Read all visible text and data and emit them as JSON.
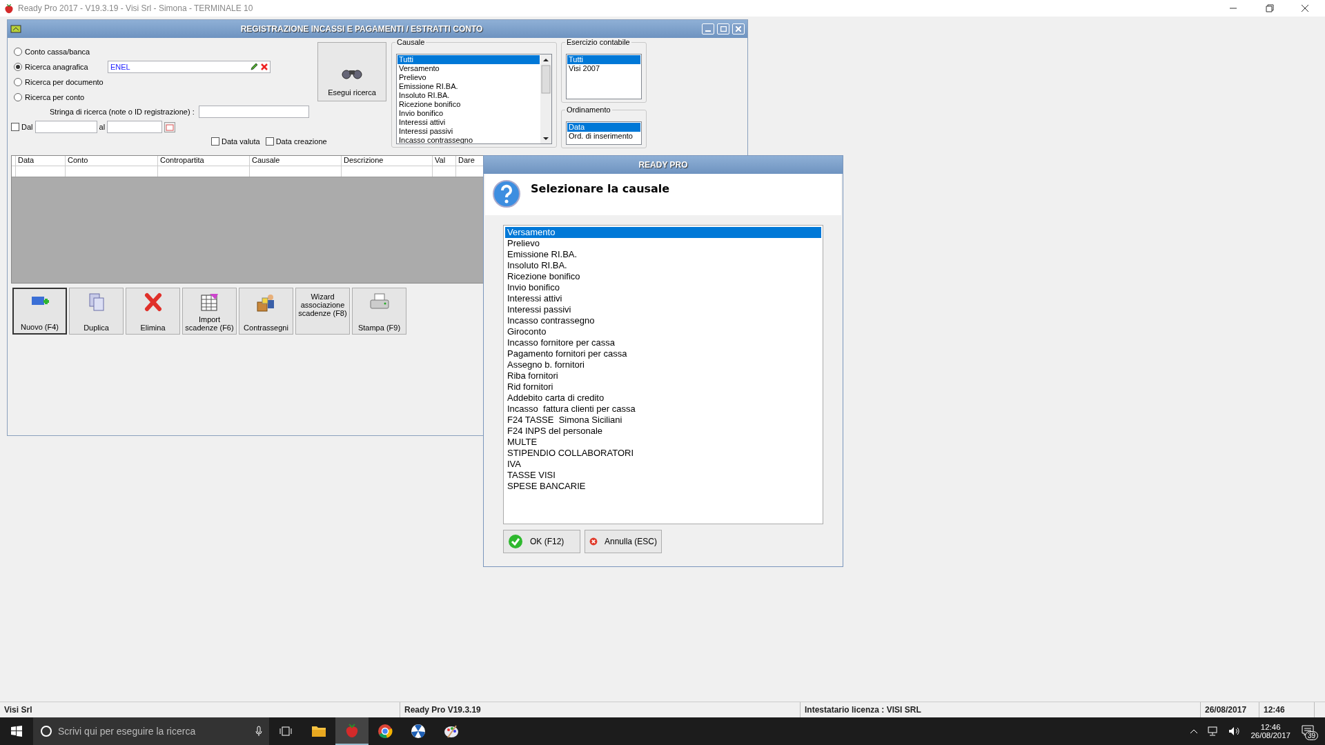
{
  "app_window": {
    "title": "Ready Pro 2017 - V19.3.19 - Visi Srl - Simona - TERMINALE 10"
  },
  "form_window": {
    "title": "REGISTRAZIONE INCASSI E PAGAMENTI / ESTRATTI CONTO",
    "search_modes": [
      {
        "label": "Conto cassa/banca",
        "selected": false
      },
      {
        "label": "Ricerca anagrafica",
        "selected": true
      },
      {
        "label": "Ricerca per documento",
        "selected": false
      },
      {
        "label": "Ricerca per conto",
        "selected": false
      }
    ],
    "search_value": "ENEL",
    "search_button": "Esegui ricerca",
    "search_string_label": "Stringa di ricerca (note o ID registrazione) :",
    "date_range": {
      "label": "Dal",
      "checked": false,
      "to_label": "al"
    },
    "date_options": [
      {
        "label": "Data valuta",
        "checked": false
      },
      {
        "label": "Data creazione",
        "checked": false
      }
    ],
    "causale": {
      "title": "Causale",
      "items": [
        {
          "label": "Tutti",
          "selected": true
        },
        {
          "label": "Versamento",
          "selected": false
        },
        {
          "label": "Prelievo",
          "selected": false
        },
        {
          "label": "Emissione RI.BA.",
          "selected": false
        },
        {
          "label": "Insoluto RI.BA.",
          "selected": false
        },
        {
          "label": "Ricezione bonifico",
          "selected": false
        },
        {
          "label": "Invio bonifico",
          "selected": false
        },
        {
          "label": "Interessi attivi",
          "selected": false
        },
        {
          "label": "Interessi passivi",
          "selected": false
        },
        {
          "label": "Incasso contrassegno",
          "selected": false
        }
      ]
    },
    "esercizio": {
      "title": "Esercizio contabile",
      "items": [
        {
          "label": "Tutti",
          "selected": true
        },
        {
          "label": "Visi 2007",
          "selected": false
        }
      ]
    },
    "ordinamento": {
      "title": "Ordinamento",
      "items": [
        {
          "label": "Data",
          "selected": true
        },
        {
          "label": "Ord. di inserimento",
          "selected": false
        }
      ]
    },
    "table": {
      "columns": [
        "Data",
        "Conto",
        "Contropartita",
        "Causale",
        "Descrizione",
        "Val",
        "Dare"
      ]
    },
    "actions": [
      {
        "label": "Nuovo (F4)",
        "kind": "new",
        "focused": true
      },
      {
        "label": "Duplica",
        "kind": "duplicate",
        "focused": false
      },
      {
        "label": "Elimina",
        "kind": "delete",
        "focused": false
      },
      {
        "label": "Import scadenze (F6)",
        "kind": "import",
        "focused": false
      },
      {
        "label": "Contrassegni",
        "kind": "cod",
        "focused": false
      },
      {
        "label": "Wizard associazione scadenze (F8)",
        "kind": "wizard",
        "focused": false
      },
      {
        "label": "Stampa (F9)",
        "kind": "print",
        "focused": false
      }
    ]
  },
  "dialog": {
    "title": "READY PRO",
    "prompt": "Selezionare la causale",
    "items": [
      {
        "label": "Versamento",
        "selected": true
      },
      {
        "label": "Prelievo",
        "selected": false
      },
      {
        "label": "Emissione RI.BA.",
        "selected": false
      },
      {
        "label": "Insoluto RI.BA.",
        "selected": false
      },
      {
        "label": "Ricezione bonifico",
        "selected": false
      },
      {
        "label": "Invio bonifico",
        "selected": false
      },
      {
        "label": "Interessi attivi",
        "selected": false
      },
      {
        "label": "Interessi passivi",
        "selected": false
      },
      {
        "label": "Incasso contrassegno",
        "selected": false
      },
      {
        "label": "Giroconto",
        "selected": false
      },
      {
        "label": "Incasso fornitore per cassa",
        "selected": false
      },
      {
        "label": "Pagamento fornitori per cassa",
        "selected": false
      },
      {
        "label": "Assegno b. fornitori",
        "selected": false
      },
      {
        "label": "Riba fornitori",
        "selected": false
      },
      {
        "label": "Rid fornitori",
        "selected": false
      },
      {
        "label": "Addebito carta di credito",
        "selected": false
      },
      {
        "label": "Incasso  fattura clienti per cassa",
        "selected": false
      },
      {
        "label": "F24 TASSE  Simona Siciliani",
        "selected": false
      },
      {
        "label": "F24 INPS del personale",
        "selected": false
      },
      {
        "label": "MULTE",
        "selected": false
      },
      {
        "label": "STIPENDIO COLLABORATORI",
        "selected": false
      },
      {
        "label": "IVA",
        "selected": false
      },
      {
        "label": "TASSE VISI",
        "selected": false
      },
      {
        "label": "SPESE BANCARIE",
        "selected": false
      }
    ],
    "buttons": [
      {
        "label": "OK (F12)",
        "kind": "ok"
      },
      {
        "label": "Annulla (ESC)",
        "kind": "cancel"
      }
    ]
  },
  "status_bar": [
    "Visi Srl",
    "Ready Pro V19.3.19",
    "Intestatario licenza : VISI SRL",
    "26/08/2017",
    "12:46"
  ],
  "taskbar": {
    "search_placeholder": "Scrivi qui per eseguire la ricerca",
    "apps": [
      {
        "kind": "folder",
        "selected": false
      },
      {
        "kind": "strawberry",
        "selected": true
      },
      {
        "kind": "chrome",
        "selected": false
      },
      {
        "kind": "radiation",
        "selected": false
      },
      {
        "kind": "palette",
        "selected": false
      }
    ],
    "time": "12:46",
    "date": "26/08/2017",
    "notifications": "39"
  }
}
